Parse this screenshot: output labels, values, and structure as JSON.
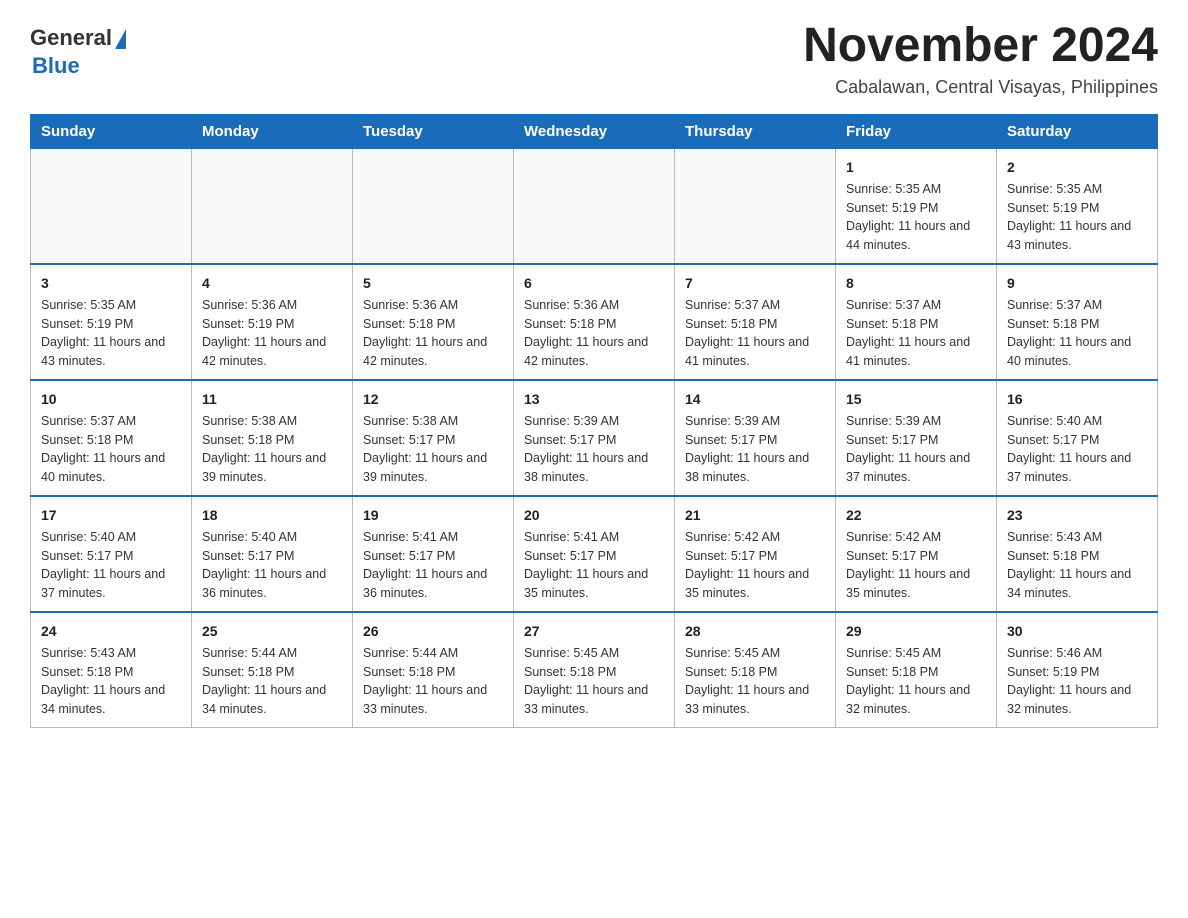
{
  "logo": {
    "general": "General",
    "triangle": "▶",
    "blue": "Blue"
  },
  "header": {
    "title": "November 2024",
    "subtitle": "Cabalawan, Central Visayas, Philippines"
  },
  "weekdays": [
    "Sunday",
    "Monday",
    "Tuesday",
    "Wednesday",
    "Thursday",
    "Friday",
    "Saturday"
  ],
  "weeks": [
    [
      {
        "day": "",
        "sunrise": "",
        "sunset": "",
        "daylight": ""
      },
      {
        "day": "",
        "sunrise": "",
        "sunset": "",
        "daylight": ""
      },
      {
        "day": "",
        "sunrise": "",
        "sunset": "",
        "daylight": ""
      },
      {
        "day": "",
        "sunrise": "",
        "sunset": "",
        "daylight": ""
      },
      {
        "day": "",
        "sunrise": "",
        "sunset": "",
        "daylight": ""
      },
      {
        "day": "1",
        "sunrise": "Sunrise: 5:35 AM",
        "sunset": "Sunset: 5:19 PM",
        "daylight": "Daylight: 11 hours and 44 minutes."
      },
      {
        "day": "2",
        "sunrise": "Sunrise: 5:35 AM",
        "sunset": "Sunset: 5:19 PM",
        "daylight": "Daylight: 11 hours and 43 minutes."
      }
    ],
    [
      {
        "day": "3",
        "sunrise": "Sunrise: 5:35 AM",
        "sunset": "Sunset: 5:19 PM",
        "daylight": "Daylight: 11 hours and 43 minutes."
      },
      {
        "day": "4",
        "sunrise": "Sunrise: 5:36 AM",
        "sunset": "Sunset: 5:19 PM",
        "daylight": "Daylight: 11 hours and 42 minutes."
      },
      {
        "day": "5",
        "sunrise": "Sunrise: 5:36 AM",
        "sunset": "Sunset: 5:18 PM",
        "daylight": "Daylight: 11 hours and 42 minutes."
      },
      {
        "day": "6",
        "sunrise": "Sunrise: 5:36 AM",
        "sunset": "Sunset: 5:18 PM",
        "daylight": "Daylight: 11 hours and 42 minutes."
      },
      {
        "day": "7",
        "sunrise": "Sunrise: 5:37 AM",
        "sunset": "Sunset: 5:18 PM",
        "daylight": "Daylight: 11 hours and 41 minutes."
      },
      {
        "day": "8",
        "sunrise": "Sunrise: 5:37 AM",
        "sunset": "Sunset: 5:18 PM",
        "daylight": "Daylight: 11 hours and 41 minutes."
      },
      {
        "day": "9",
        "sunrise": "Sunrise: 5:37 AM",
        "sunset": "Sunset: 5:18 PM",
        "daylight": "Daylight: 11 hours and 40 minutes."
      }
    ],
    [
      {
        "day": "10",
        "sunrise": "Sunrise: 5:37 AM",
        "sunset": "Sunset: 5:18 PM",
        "daylight": "Daylight: 11 hours and 40 minutes."
      },
      {
        "day": "11",
        "sunrise": "Sunrise: 5:38 AM",
        "sunset": "Sunset: 5:18 PM",
        "daylight": "Daylight: 11 hours and 39 minutes."
      },
      {
        "day": "12",
        "sunrise": "Sunrise: 5:38 AM",
        "sunset": "Sunset: 5:17 PM",
        "daylight": "Daylight: 11 hours and 39 minutes."
      },
      {
        "day": "13",
        "sunrise": "Sunrise: 5:39 AM",
        "sunset": "Sunset: 5:17 PM",
        "daylight": "Daylight: 11 hours and 38 minutes."
      },
      {
        "day": "14",
        "sunrise": "Sunrise: 5:39 AM",
        "sunset": "Sunset: 5:17 PM",
        "daylight": "Daylight: 11 hours and 38 minutes."
      },
      {
        "day": "15",
        "sunrise": "Sunrise: 5:39 AM",
        "sunset": "Sunset: 5:17 PM",
        "daylight": "Daylight: 11 hours and 37 minutes."
      },
      {
        "day": "16",
        "sunrise": "Sunrise: 5:40 AM",
        "sunset": "Sunset: 5:17 PM",
        "daylight": "Daylight: 11 hours and 37 minutes."
      }
    ],
    [
      {
        "day": "17",
        "sunrise": "Sunrise: 5:40 AM",
        "sunset": "Sunset: 5:17 PM",
        "daylight": "Daylight: 11 hours and 37 minutes."
      },
      {
        "day": "18",
        "sunrise": "Sunrise: 5:40 AM",
        "sunset": "Sunset: 5:17 PM",
        "daylight": "Daylight: 11 hours and 36 minutes."
      },
      {
        "day": "19",
        "sunrise": "Sunrise: 5:41 AM",
        "sunset": "Sunset: 5:17 PM",
        "daylight": "Daylight: 11 hours and 36 minutes."
      },
      {
        "day": "20",
        "sunrise": "Sunrise: 5:41 AM",
        "sunset": "Sunset: 5:17 PM",
        "daylight": "Daylight: 11 hours and 35 minutes."
      },
      {
        "day": "21",
        "sunrise": "Sunrise: 5:42 AM",
        "sunset": "Sunset: 5:17 PM",
        "daylight": "Daylight: 11 hours and 35 minutes."
      },
      {
        "day": "22",
        "sunrise": "Sunrise: 5:42 AM",
        "sunset": "Sunset: 5:17 PM",
        "daylight": "Daylight: 11 hours and 35 minutes."
      },
      {
        "day": "23",
        "sunrise": "Sunrise: 5:43 AM",
        "sunset": "Sunset: 5:18 PM",
        "daylight": "Daylight: 11 hours and 34 minutes."
      }
    ],
    [
      {
        "day": "24",
        "sunrise": "Sunrise: 5:43 AM",
        "sunset": "Sunset: 5:18 PM",
        "daylight": "Daylight: 11 hours and 34 minutes."
      },
      {
        "day": "25",
        "sunrise": "Sunrise: 5:44 AM",
        "sunset": "Sunset: 5:18 PM",
        "daylight": "Daylight: 11 hours and 34 minutes."
      },
      {
        "day": "26",
        "sunrise": "Sunrise: 5:44 AM",
        "sunset": "Sunset: 5:18 PM",
        "daylight": "Daylight: 11 hours and 33 minutes."
      },
      {
        "day": "27",
        "sunrise": "Sunrise: 5:45 AM",
        "sunset": "Sunset: 5:18 PM",
        "daylight": "Daylight: 11 hours and 33 minutes."
      },
      {
        "day": "28",
        "sunrise": "Sunrise: 5:45 AM",
        "sunset": "Sunset: 5:18 PM",
        "daylight": "Daylight: 11 hours and 33 minutes."
      },
      {
        "day": "29",
        "sunrise": "Sunrise: 5:45 AM",
        "sunset": "Sunset: 5:18 PM",
        "daylight": "Daylight: 11 hours and 32 minutes."
      },
      {
        "day": "30",
        "sunrise": "Sunrise: 5:46 AM",
        "sunset": "Sunset: 5:19 PM",
        "daylight": "Daylight: 11 hours and 32 minutes."
      }
    ]
  ]
}
